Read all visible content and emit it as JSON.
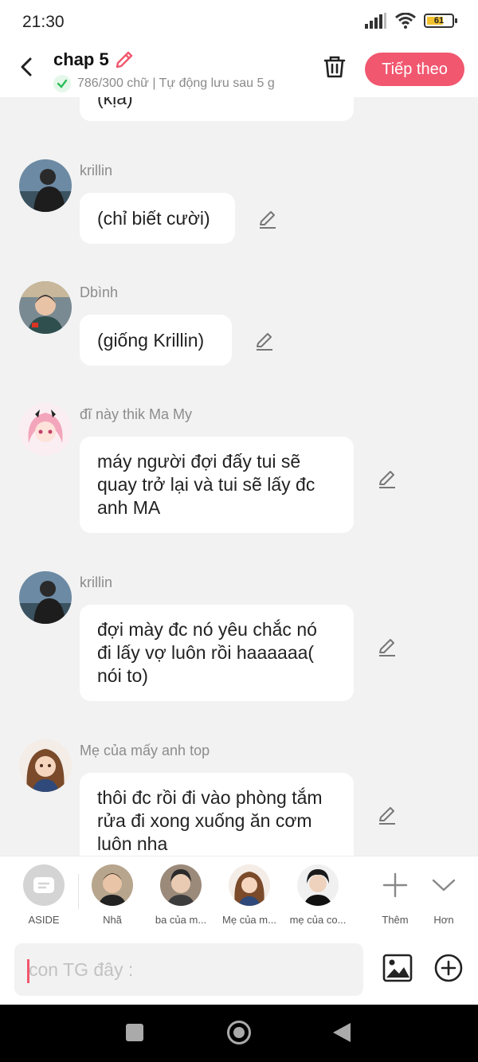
{
  "status_bar": {
    "time": "21:30",
    "battery": "61"
  },
  "header": {
    "title": "chap 5",
    "subtitle": "786/300 chữ | Tự động lưu sau 5 g",
    "next_label": "Tiếp theo"
  },
  "messages": [
    {
      "name": "",
      "text": "(kịa)"
    },
    {
      "name": "krillin",
      "text": "(chỉ biết cười)"
    },
    {
      "name": "Dbình",
      "text": "(giống Krillin)"
    },
    {
      "name": "đĩ này thik Ma My",
      "text": "máy người đợi đấy tui sẽ quay trở lại và tui sẽ lấy đc anh MA"
    },
    {
      "name": "krillin",
      "text": "đợi mày đc nó yêu chắc nó đi lấy vợ luôn rồi haaaaaa( nói to)"
    },
    {
      "name": "Mẹ của mấy anh top",
      "text": "thôi đc rồi đi vào phòng tắm rửa đi xong xuống ăn cơm luôn nha"
    }
  ],
  "characters": [
    {
      "label": "ASIDE"
    },
    {
      "label": "Nhã"
    },
    {
      "label": "ba của m..."
    },
    {
      "label": "Mẹ của m..."
    },
    {
      "label": "mẹ của co..."
    },
    {
      "label": "Thêm"
    },
    {
      "label": "Hơn"
    }
  ],
  "input": {
    "placeholder": "con TG đây :"
  },
  "colors": {
    "accent": "#f1576f",
    "background": "#f2f2f2",
    "bubble": "#ffffff"
  }
}
